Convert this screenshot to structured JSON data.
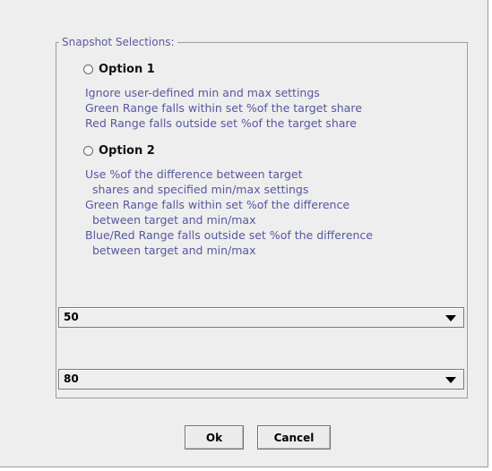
{
  "group": {
    "title": "Snapshot Selections:"
  },
  "option1": {
    "label": "Option 1",
    "description": "Ignore user-defined min and max settings\nGreen Range falls within set %of the target share\nRed Range falls outside set %of the target share"
  },
  "option2": {
    "label": "Option 2",
    "description": "Use %of the difference between target\n  shares and specified min/max settings\nGreen Range falls within set %of the difference\n  between target and min/max\nBlue/Red Range falls outside set %of the difference\n  between target and min/max"
  },
  "combo1": {
    "value": "50"
  },
  "combo2": {
    "value": "80"
  },
  "buttons": {
    "ok": "Ok",
    "cancel": "Cancel"
  },
  "icons": {
    "radio": "radio-button-icon",
    "dropdown": "chevron-down-icon"
  },
  "colors": {
    "text_accent": "#5757a0",
    "background": "#eeeeee"
  }
}
